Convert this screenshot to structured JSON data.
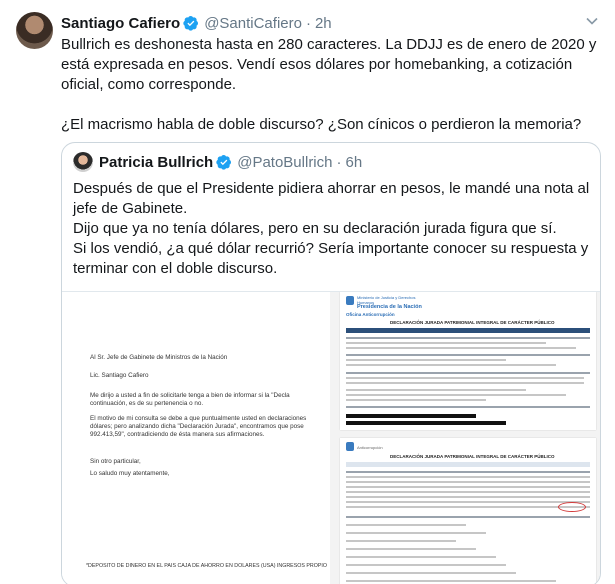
{
  "tweet": {
    "author_name": "Santiago Cafiero",
    "author_handle": "@SantiCafiero",
    "separator": "·",
    "time": "2h",
    "paragraph1": "Bullrich es deshonesta hasta en 280 caracteres. La DDJJ es de enero de 2020 y está expresada en pesos. Vendí esos dólares por homebanking, a cotización oficial, como corresponde.",
    "paragraph2": "¿El macrismo habla de doble discurso? ¿Son cínicos o perdieron la memoria?"
  },
  "quoted": {
    "author_name": "Patricia Bullrich",
    "author_handle": "@PatoBullrich",
    "separator": "·",
    "time": "6h",
    "lines": [
      "Después de que el Presidente pidiera ahorrar en pesos, le mandé una nota al jefe de Gabinete.",
      "Dijo que ya no tenía dólares, pero en su declaración jurada figura que sí.",
      "Si los vendió, ¿a qué dólar recurrió? Sería importante conocer su respuesta y terminar con el doble discurso."
    ]
  },
  "letter": {
    "addressee": "Al Sr. Jefe de Gabinete de Ministros de la Nación",
    "addressee_name": "Lic. Santiago Cafiero",
    "body1a": "Me dirijo a usted a fin de solicitarle tenga a bien de informar si la \"Decla",
    "body1b": "continuación, es de su pertenencia o no.",
    "body2a": "El motivo de mi consulta se debe a que puntualmente usted en declaraciones",
    "body2b": "dólares; pero analizando dicha \"Declaración Jurada\", encontramos que pose",
    "body2c": "992.413,59\", contradiciendo de ésta manera sus afirmaciones.",
    "closing1": "Sin otro particular,",
    "closing2": "Lo saludo muy atentamente,",
    "footnote": "*DEPOSITO DE DINERO EN EL PAIS CAJA DE AHORRO EN DOLARES (USA) INGRESOS PROPIO"
  },
  "document": {
    "ministry": "Ministerio de Justicia y Derechos Humanos",
    "presidency": "Presidencia de la Nación",
    "office": "Oficina Anticorrupción",
    "title": "DECLARACIÓN JURADA PATRIMONIAL INTEGRAL DE CARÁCTER PÚBLICO",
    "stamp": "Anticorrupción"
  },
  "colors": {
    "text": "#14171a",
    "secondary": "#657786",
    "border": "#ccd6dd",
    "verified": "#1da1f2",
    "doc_blue": "#2a6db5",
    "doc_header": "#2b4f7a",
    "circle_red": "#d23b3b"
  },
  "icons": [
    "verified-badge-icon",
    "chevron-down-icon"
  ]
}
